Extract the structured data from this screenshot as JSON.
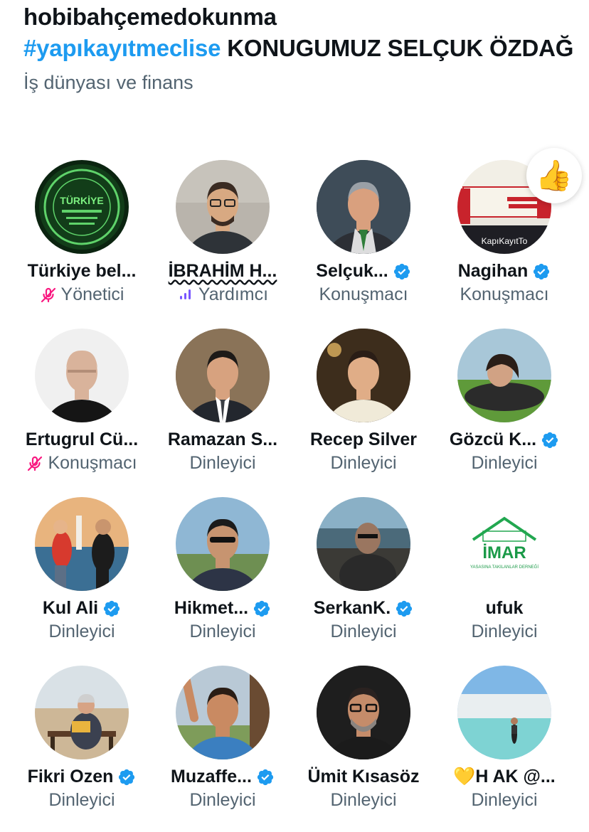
{
  "space": {
    "host": "hobibahçemedokunma",
    "title_hashtag": "#yapıkayıtmeclise",
    "title_rest": " KONUGUMUZ SELÇUK ÖZDAĞ",
    "topic": "İş dünyası ve finans"
  },
  "participants": [
    {
      "name": "Türkiye bel...",
      "role": "Yönetici",
      "role_icon": "mic-off-icon",
      "verified": false,
      "avatar": "green-logo",
      "avatar_text": "TÜRKİYE"
    },
    {
      "name": "İBRAHİM H...",
      "role": "Yardımcı",
      "role_icon": "speaking-bars-icon",
      "verified": false,
      "avatar": "man-glasses"
    },
    {
      "name": "Selçuk...",
      "role": "Konuşmacı",
      "verified": true,
      "avatar": "man-suit-gray"
    },
    {
      "name": "Nagihan",
      "role": "Konuşmacı",
      "verified": true,
      "avatar": "protest-banner",
      "avatar_text": "KapıKayıtTo",
      "reaction": "👍"
    },
    {
      "name": "Ertugrul Cü...",
      "role": "Konuşmacı",
      "role_icon": "mic-off-icon",
      "verified": false,
      "avatar": "bald-man"
    },
    {
      "name": "Ramazan S...",
      "role": "Dinleyici",
      "verified": false,
      "avatar": "man-suit-dark"
    },
    {
      "name": "Recep Silver",
      "role": "Dinleyici",
      "verified": false,
      "avatar": "man-white-suit"
    },
    {
      "name": "Gözcü K...",
      "role": "Dinleyici",
      "verified": true,
      "avatar": "woman-grass"
    },
    {
      "name": "Kul Ali",
      "role": "Dinleyici",
      "verified": true,
      "avatar": "couple-tower"
    },
    {
      "name": "Hikmet...",
      "role": "Dinleyici",
      "verified": true,
      "avatar": "man-sunglasses"
    },
    {
      "name": "SerkanK.",
      "role": "Dinleyici",
      "verified": true,
      "avatar": "man-balcony"
    },
    {
      "name": "ufuk",
      "role": "Dinleyici",
      "verified": false,
      "avatar": "imar-logo",
      "avatar_text": "İMAR",
      "avatar_subtext": "YASASINA TAKILANLAR DERNEĞİ"
    },
    {
      "name": "Fikri Ozen",
      "role": "Dinleyici",
      "verified": true,
      "avatar": "man-bench"
    },
    {
      "name": "Muzaffe...",
      "role": "Dinleyici",
      "verified": true,
      "avatar": "child-wave"
    },
    {
      "name": "Ümit Kısasöz",
      "role": "Dinleyici",
      "verified": false,
      "avatar": "man-beard-glasses"
    },
    {
      "name": "💛H AK @...",
      "role": "Dinleyici",
      "verified": false,
      "avatar": "pamukkale"
    }
  ],
  "colors": {
    "accent": "#1d9bf0",
    "muted": "#536471",
    "mic_off": "#f91880",
    "speaking": "#7856ff"
  }
}
